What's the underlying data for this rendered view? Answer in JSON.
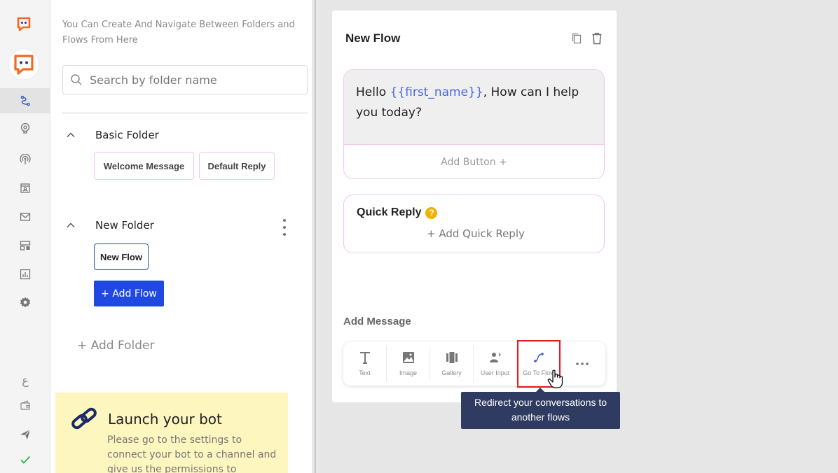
{
  "rail": {
    "brand_color": "#f26a21",
    "icons": [
      "logo-icon",
      "bot-avatar-icon",
      "flows-icon",
      "bot-brain-icon",
      "broadcast-icon",
      "contacts-icon",
      "mail-icon",
      "templates-icon",
      "analytics-icon",
      "settings-icon",
      "language-icon",
      "wallet-icon",
      "send-icon",
      "check-icon"
    ],
    "language_label": "ع"
  },
  "panel": {
    "hint": "You Can Create And Navigate Between Folders and Flows From Here",
    "search_placeholder": "Search by folder name",
    "folders": [
      {
        "name": "Basic Folder",
        "flows": [
          "Welcome Message",
          "Default Reply"
        ]
      },
      {
        "name": "New Folder",
        "flows": [
          "New Flow"
        ]
      }
    ],
    "add_flow_label": "+ Add Flow",
    "add_folder_label": "+ Add Folder"
  },
  "launch": {
    "title": "Launch your bot",
    "body": "Please go to the settings to connect your bot to a channel and give us the permissions to"
  },
  "flow": {
    "title": "New Flow",
    "message_prefix": "Hello ",
    "message_var": "{{first_name}}",
    "message_suffix": ", How can I help you today?",
    "add_button_label": "Add Button +",
    "quick_reply_label": "Quick Reply",
    "add_quick_reply_label": "+ Add Quick Reply",
    "add_message_label": "Add Message",
    "tools": [
      "Text",
      "Image",
      "Gallery",
      "User Input",
      "Go To Flow"
    ],
    "accent": "#1f49e0"
  },
  "tooltip": {
    "text": "Redirect your conversations to another flows"
  }
}
